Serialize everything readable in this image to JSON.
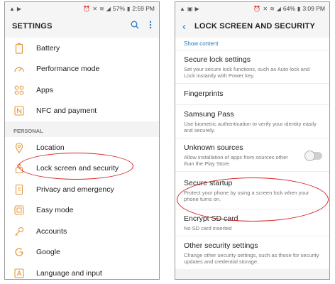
{
  "left_screen": {
    "status": {
      "icons_left": [
        "notification-icon",
        "play-icon"
      ],
      "icons_right": [
        "alarm-icon",
        "mute-icon",
        "wifi-icon",
        "signal-icon"
      ],
      "battery": "57%",
      "time": "2:59 PM"
    },
    "title": "SETTINGS",
    "items_group1": [
      {
        "label": "Battery",
        "icon": "battery-icon"
      },
      {
        "label": "Performance mode",
        "icon": "speedometer-icon"
      },
      {
        "label": "Apps",
        "icon": "apps-grid-icon"
      },
      {
        "label": "NFC and payment",
        "icon": "nfc-icon"
      }
    ],
    "section_personal": "PERSONAL",
    "items_group2": [
      {
        "label": "Location",
        "icon": "location-pin-icon"
      },
      {
        "label": "Lock screen and security",
        "icon": "lock-icon"
      },
      {
        "label": "Privacy and emergency",
        "icon": "privacy-icon"
      },
      {
        "label": "Easy mode",
        "icon": "easy-mode-icon"
      },
      {
        "label": "Accounts",
        "icon": "key-icon"
      },
      {
        "label": "Google",
        "icon": "google-icon"
      },
      {
        "label": "Language and input",
        "icon": "language-icon"
      }
    ]
  },
  "right_screen": {
    "status": {
      "icons_left": [
        "notification-icon",
        "image-icon",
        "play-icon"
      ],
      "icons_right": [
        "alarm-icon",
        "mute-icon",
        "wifi-icon",
        "signal-icon"
      ],
      "battery": "64%",
      "time": "3:09 PM"
    },
    "title": "LOCK SCREEN AND SECURITY",
    "show_content": "Show content",
    "items": [
      {
        "title": "Secure lock settings",
        "desc": "Set your secure lock functions, such as Auto lock and Lock instantly with Power key."
      },
      {
        "title": "Fingerprints",
        "desc": ""
      },
      {
        "title": "Samsung Pass",
        "desc": "Use biometric authentication to verify your identity easily and securely."
      },
      {
        "title": "Unknown sources",
        "desc": "Allow installation of apps from sources other than the Play Store.",
        "toggle": false
      },
      {
        "title": "Secure startup",
        "desc": "Protect your phone by using a screen lock when your phone turns on."
      },
      {
        "title": "Encrypt SD card",
        "desc": "No SD card inserted"
      },
      {
        "title": "Other security settings",
        "desc": "Change other security settings, such as those for security updates and credential storage."
      }
    ]
  },
  "colors": {
    "accent": "#2a7bc0",
    "icon_orange": "#e8973a",
    "highlight_red": "#d62020"
  }
}
